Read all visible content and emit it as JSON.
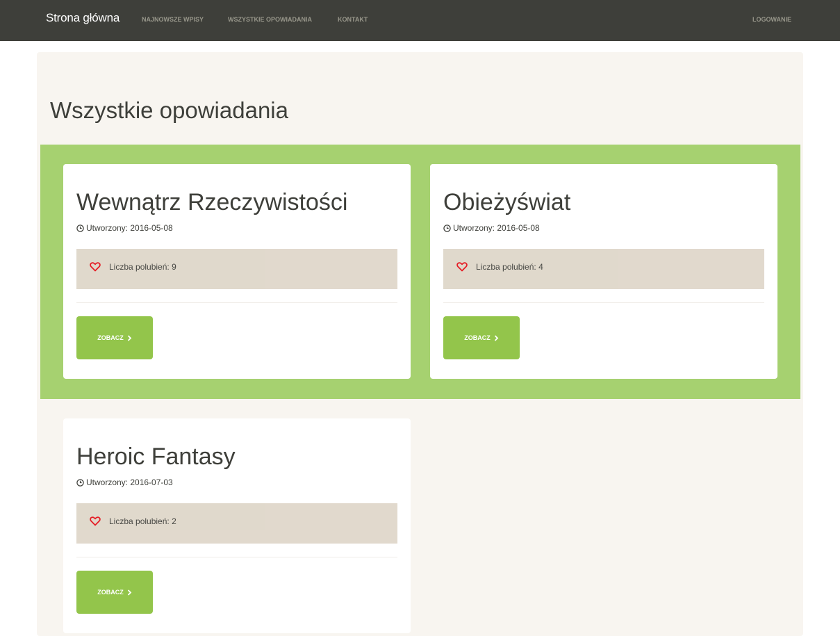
{
  "navbar": {
    "brand": "Strona główna",
    "links": [
      "NAJNOWSZE WPISY",
      "WSZYSTKIE OPOWIADANIA",
      "KONTAKT"
    ],
    "login": "LOGOWANIE"
  },
  "page": {
    "title": "Wszystkie opowiadania"
  },
  "colors": {
    "navbar": "#3e3f3a",
    "accent": "#93c54b",
    "band": "#a6d170",
    "likes_box": "#dfd7ca",
    "heart": "#e4131b"
  },
  "stories": [
    {
      "title": "Wewnątrz Rzeczywistości",
      "created": "Utworzony: 2016-05-08",
      "likes": "Liczba polubień: 9",
      "button": "ZOBACZ",
      "icons": [
        "clock-icon",
        "heart-icon",
        "chevron-right-icon"
      ]
    },
    {
      "title": "Obieżyświat",
      "created": "Utworzony: 2016-05-08",
      "likes": "Liczba polubień: 4",
      "button": "ZOBACZ",
      "icons": [
        "clock-icon",
        "heart-icon",
        "chevron-right-icon"
      ]
    },
    {
      "title": "Heroic Fantasy",
      "created": "Utworzony: 2016-07-03",
      "likes": "Liczba polubień: 2",
      "button": "ZOBACZ",
      "icons": [
        "clock-icon",
        "heart-icon",
        "chevron-right-icon"
      ]
    }
  ]
}
